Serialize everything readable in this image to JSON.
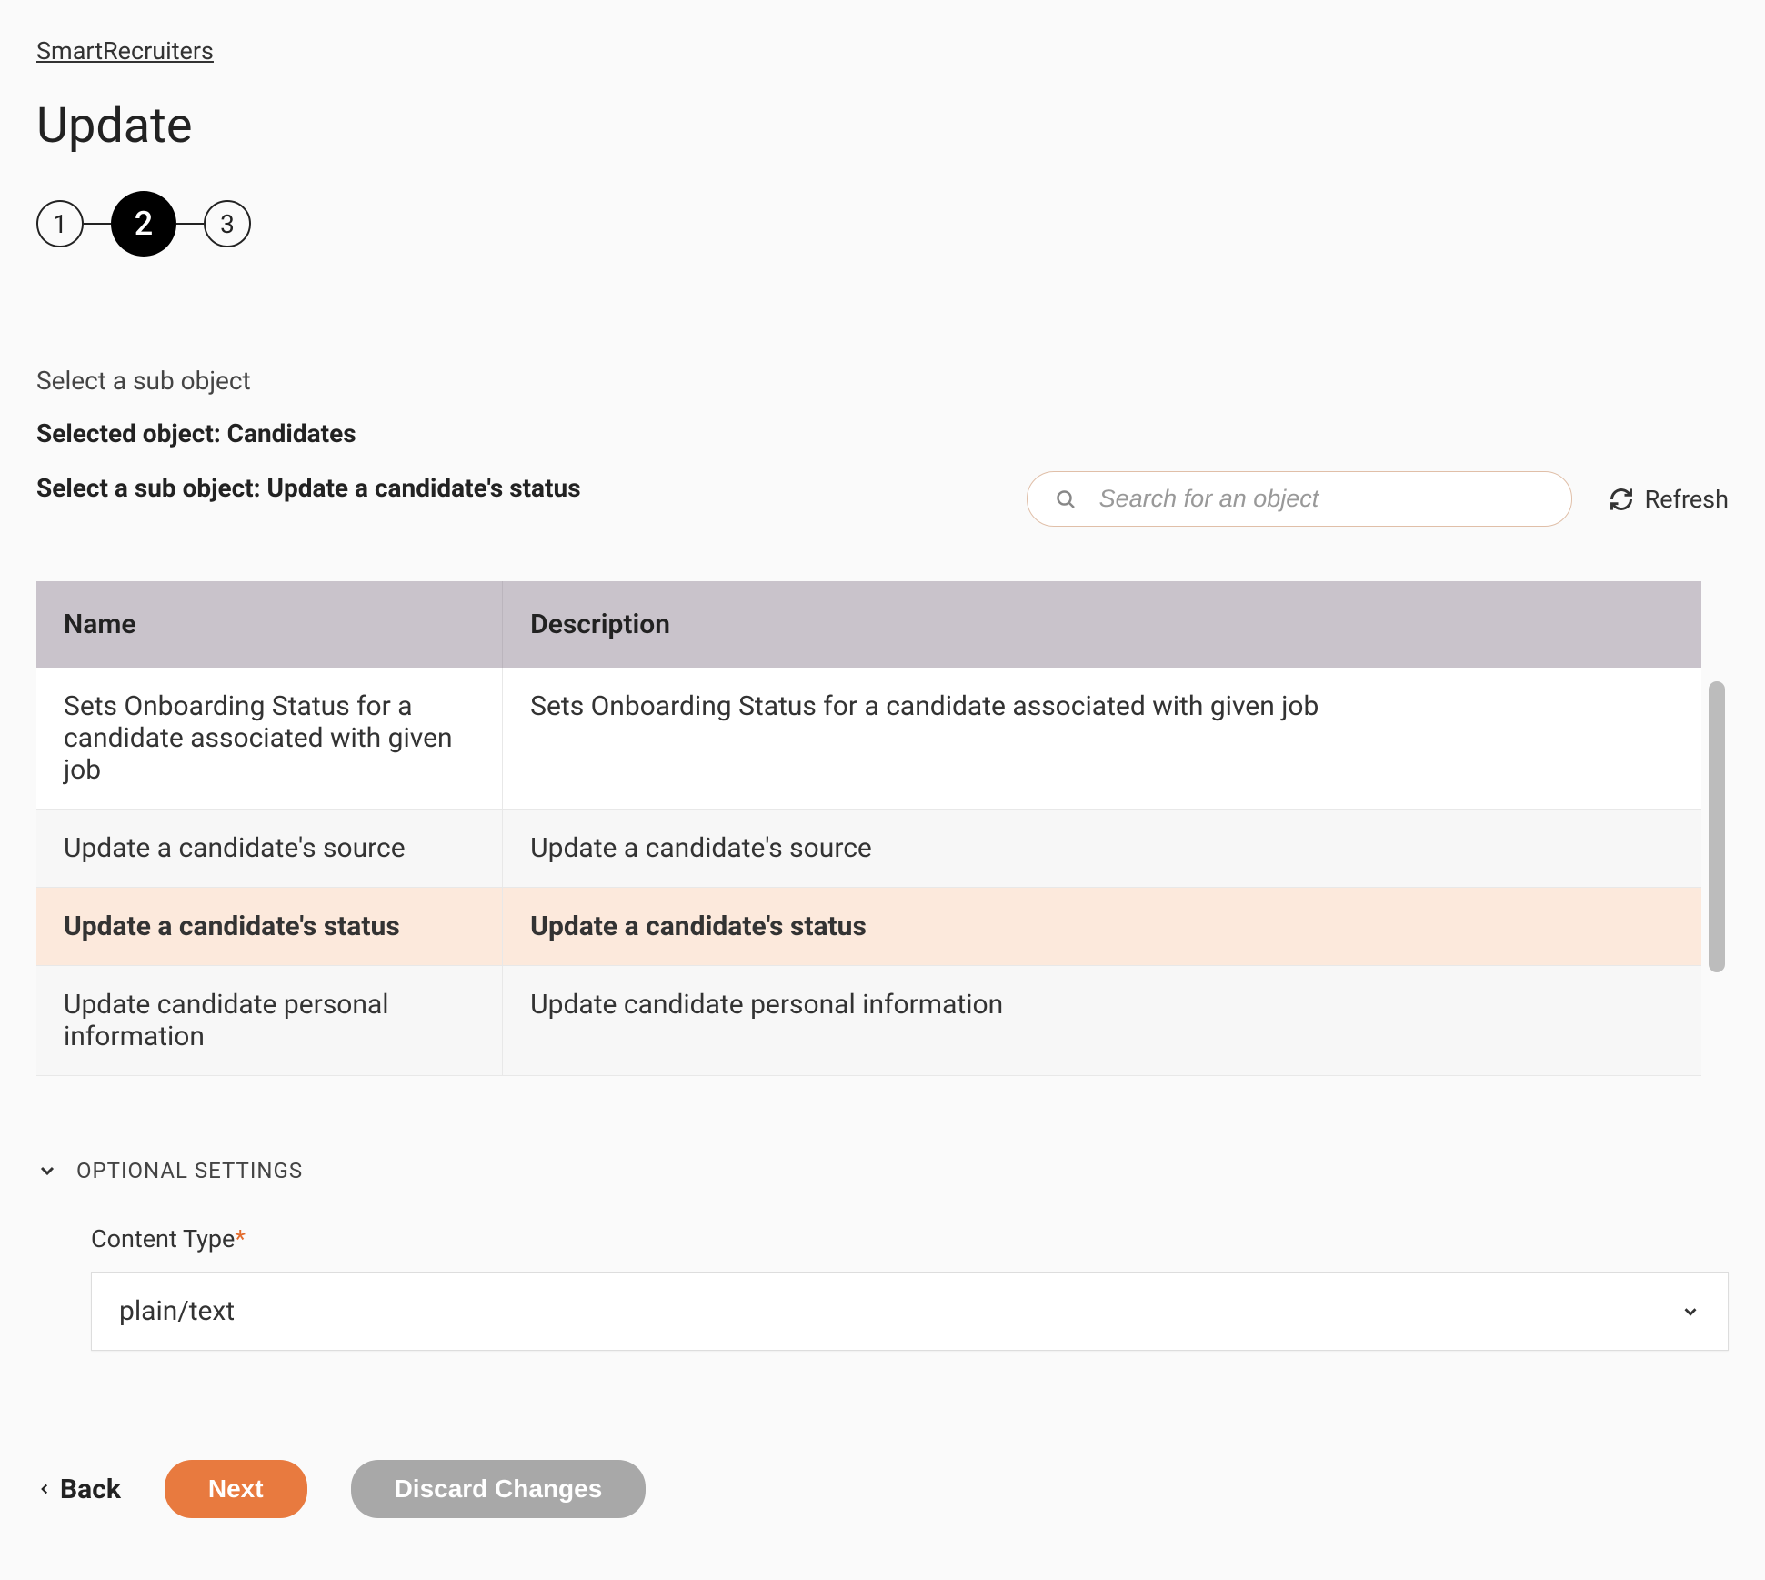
{
  "breadcrumb": "SmartRecruiters",
  "page_title": "Update",
  "stepper": {
    "steps": [
      "1",
      "2",
      "3"
    ],
    "active": 2
  },
  "subtitle": "Select a sub object",
  "selected_object_label": "Selected object: Candidates",
  "selected_sub_object_label": "Select a sub object: Update a candidate's status",
  "search": {
    "placeholder": "Search for an object"
  },
  "refresh_label": "Refresh",
  "table": {
    "headers": {
      "name": "Name",
      "description": "Description"
    },
    "rows": [
      {
        "name": "Sets Onboarding Status for a candidate associated with given job",
        "description": "Sets Onboarding Status for a candidate associated with given job",
        "selected": false,
        "alt": false
      },
      {
        "name": "Update a candidate's source",
        "description": "Update a candidate's source",
        "selected": false,
        "alt": true
      },
      {
        "name": "Update a candidate's status",
        "description": "Update a candidate's status",
        "selected": true,
        "alt": false
      },
      {
        "name": "Update candidate personal information",
        "description": "Update candidate personal information",
        "selected": false,
        "alt": true
      }
    ]
  },
  "optional_settings": {
    "title": "OPTIONAL SETTINGS",
    "content_type": {
      "label": "Content Type",
      "value": "plain/text"
    }
  },
  "footer": {
    "back": "Back",
    "next": "Next",
    "discard": "Discard Changes"
  }
}
